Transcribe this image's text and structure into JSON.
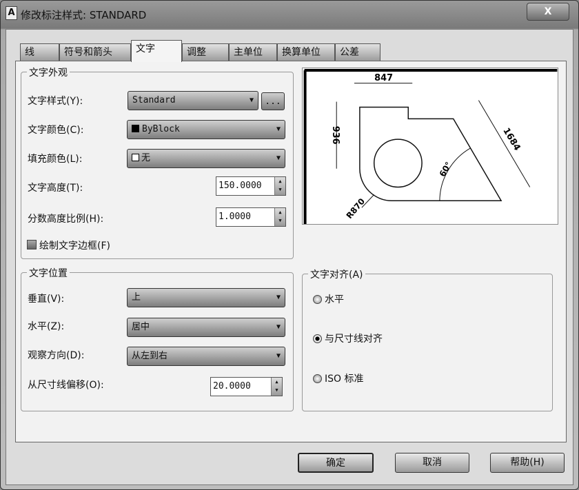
{
  "window": {
    "title": "修改标注样式: STANDARD",
    "close_label": "X",
    "app_icon": "A"
  },
  "tabs": [
    {
      "label": "线"
    },
    {
      "label": "符号和箭头"
    },
    {
      "label": "文字"
    },
    {
      "label": "调整"
    },
    {
      "label": "主单位"
    },
    {
      "label": "换算单位"
    },
    {
      "label": "公差"
    }
  ],
  "appearance": {
    "title": "文字外观",
    "text_style_label": "文字样式(Y):",
    "text_style_value": "Standard",
    "browse_label": "...",
    "text_color_label": "文字颜色(C):",
    "text_color_value": "ByBlock",
    "fill_color_label": "填充颜色(L):",
    "fill_color_value": "无",
    "text_height_label": "文字高度(T):",
    "text_height_value": "150.0000",
    "fraction_scale_label": "分数高度比例(H):",
    "fraction_scale_value": "1.0000",
    "draw_frame_label": "绘制文字边框(F)",
    "draw_frame_checked": false
  },
  "placement": {
    "title": "文字位置",
    "vertical_label": "垂直(V):",
    "vertical_value": "上",
    "horizontal_label": "水平(Z):",
    "horizontal_value": "居中",
    "view_dir_label": "观察方向(D):",
    "view_dir_value": "从左到右",
    "offset_label": "从尺寸线偏移(O):",
    "offset_value": "20.0000"
  },
  "alignment": {
    "title": "文字对齐(A)",
    "options": [
      {
        "label": "水平",
        "selected": false
      },
      {
        "label": "与尺寸线对齐",
        "selected": true
      },
      {
        "label": "ISO 标准",
        "selected": false
      }
    ]
  },
  "preview": {
    "dim_top": "847",
    "dim_left": "936",
    "dim_diag": "1684",
    "dim_angle": "60°",
    "dim_radius": "R870"
  },
  "buttons": {
    "ok": "确定",
    "cancel": "取消",
    "help": "帮助(H)"
  }
}
